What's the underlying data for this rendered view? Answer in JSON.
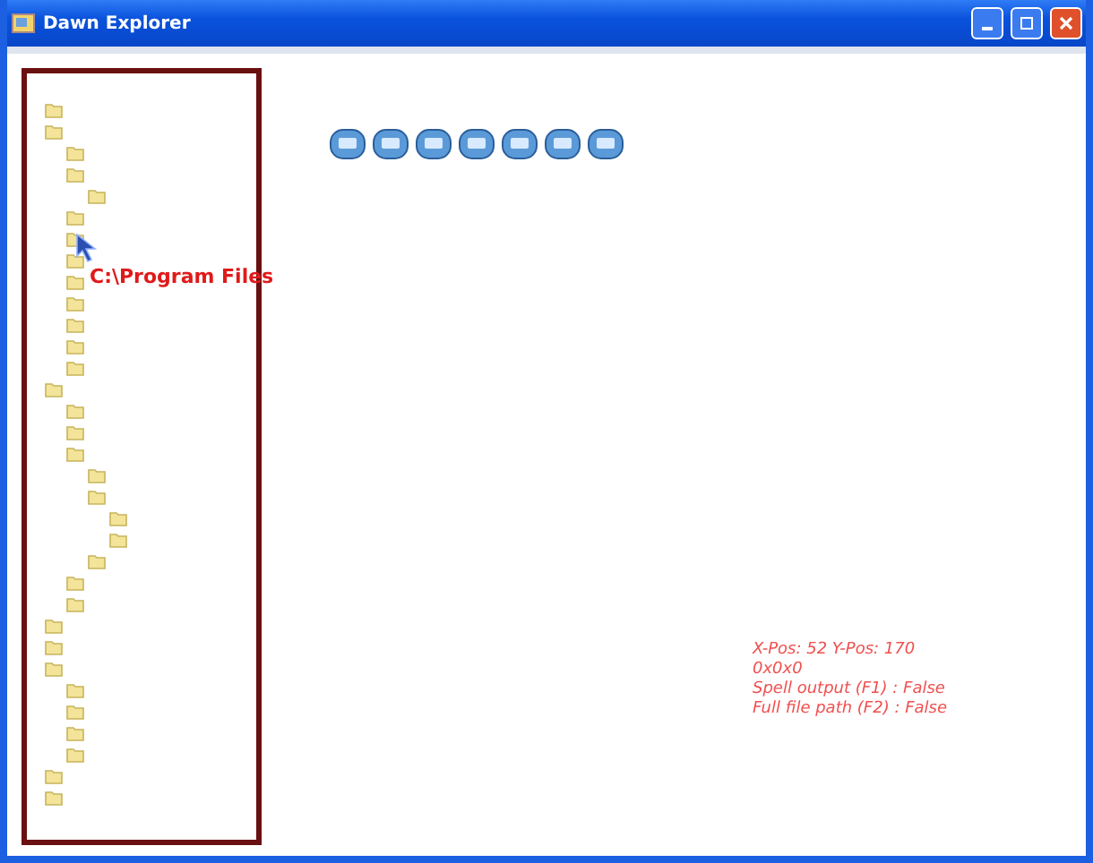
{
  "window": {
    "title": "Dawn Explorer"
  },
  "tree": [
    {
      "kind": "folder"
    },
    {
      "kind": "folder",
      "children": [
        {
          "kind": "folder"
        },
        {
          "kind": "folder",
          "children": [
            {
              "kind": "folder"
            }
          ]
        },
        {
          "kind": "folder"
        },
        {
          "kind": "folder"
        },
        {
          "kind": "folder"
        },
        {
          "kind": "folder"
        },
        {
          "kind": "folder"
        },
        {
          "kind": "folder"
        },
        {
          "kind": "folder"
        },
        {
          "kind": "folder"
        }
      ]
    },
    {
      "kind": "folder",
      "children": [
        {
          "kind": "folder"
        },
        {
          "kind": "folder"
        },
        {
          "kind": "folder",
          "children": [
            {
              "kind": "folder"
            },
            {
              "kind": "folder",
              "children": [
                {
                  "kind": "folder"
                },
                {
                  "kind": "folder"
                }
              ]
            },
            {
              "kind": "folder"
            }
          ]
        },
        {
          "kind": "folder"
        },
        {
          "kind": "folder"
        }
      ]
    },
    {
      "kind": "folder"
    },
    {
      "kind": "folder"
    },
    {
      "kind": "folder",
      "children": [
        {
          "kind": "folder"
        },
        {
          "kind": "folder"
        },
        {
          "kind": "folder"
        },
        {
          "kind": "folder"
        }
      ]
    },
    {
      "kind": "folder"
    },
    {
      "kind": "folder"
    }
  ],
  "hover_label": "C:\\Program Files",
  "toolbar": [
    {
      "kind": "file"
    },
    {
      "kind": "file"
    },
    {
      "kind": "file"
    },
    {
      "kind": "file"
    },
    {
      "kind": "file"
    },
    {
      "kind": "file"
    },
    {
      "kind": "file"
    }
  ],
  "status_lines": [
    "X-Pos: 52 Y-Pos: 170",
    "0x0x0",
    "Spell output (F1) : False",
    "Full file path (F2) : False"
  ]
}
